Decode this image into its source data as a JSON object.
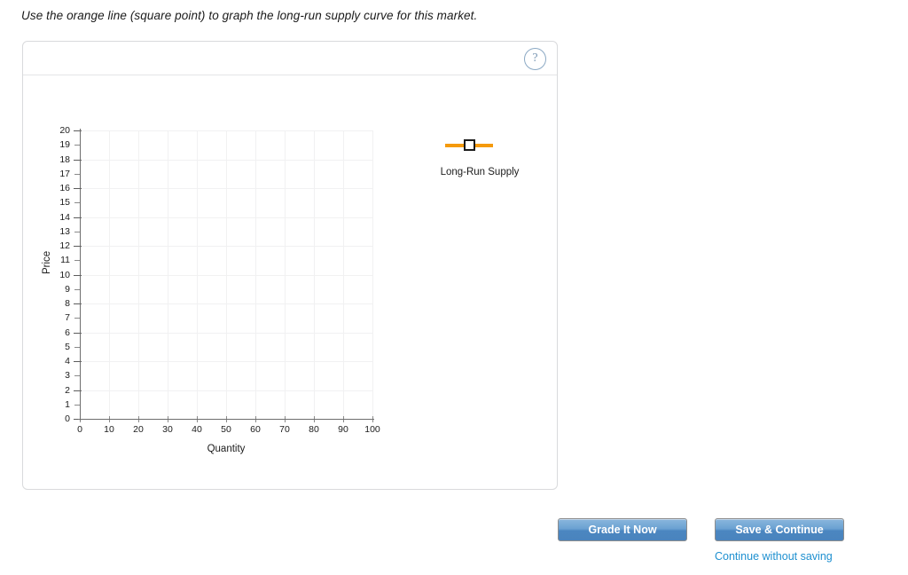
{
  "instruction": "Use the orange line (square point) to graph the long-run supply curve for this market.",
  "panel": {
    "help_icon_label": "?"
  },
  "legend": {
    "label": "Long-Run Supply",
    "color": "#f59a0c",
    "marker": "square",
    "marker_fill": "#ffffff",
    "marker_border": "#1a1a1a"
  },
  "footer": {
    "grade_label": "Grade It Now",
    "save_label": "Save & Continue",
    "continue_link": "Continue without saving",
    "button_color": "#4b86c0",
    "link_color": "#1e90d0"
  },
  "chart_data": {
    "type": "line",
    "title": "",
    "xlabel": "Quantity",
    "ylabel": "Price",
    "xlim": [
      0,
      100
    ],
    "ylim": [
      0,
      20
    ],
    "x_ticks": [
      0,
      10,
      20,
      30,
      40,
      50,
      60,
      70,
      80,
      90,
      100
    ],
    "y_ticks": [
      0,
      1,
      2,
      3,
      4,
      5,
      6,
      7,
      8,
      9,
      10,
      11,
      12,
      13,
      14,
      15,
      16,
      17,
      18,
      19,
      20
    ],
    "y_tick_labels": [
      "0",
      "1",
      "2",
      "3",
      "4",
      "5",
      "6",
      "7",
      "8",
      "9",
      "10",
      "11",
      "12",
      "13",
      "14",
      "15",
      "16",
      "17",
      "18",
      "19",
      "20"
    ],
    "x_tick_labels": [
      "0",
      "10",
      "20",
      "30",
      "40",
      "50",
      "60",
      "70",
      "80",
      "90",
      "100"
    ],
    "grid": true,
    "grid_x_step": 10,
    "grid_y_step": 2,
    "legend_position": "right",
    "series": [
      {
        "name": "Long-Run Supply",
        "color": "#f59a0c",
        "marker": "square",
        "x": [],
        "y": [],
        "plotted": false
      }
    ]
  }
}
